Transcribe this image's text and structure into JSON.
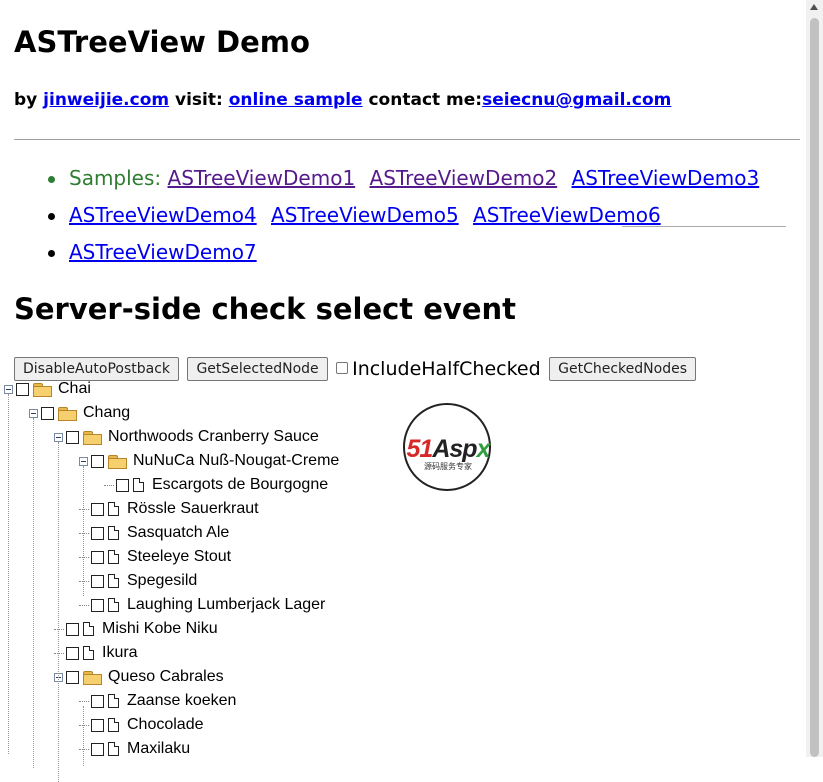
{
  "page": {
    "title": "ASTreeView Demo",
    "by_prefix": "by ",
    "author_link": "jinweijie.com",
    "visit_label": " visit: ",
    "online_link": "online sample",
    "contact_label": " contact me:",
    "email_link": "seiecnu@gmail.com"
  },
  "samples": {
    "label": "Samples:",
    "links": [
      "ASTreeViewDemo1",
      "ASTreeViewDemo2",
      "ASTreeViewDemo3",
      "ASTreeViewDemo4",
      "ASTreeViewDemo5",
      "ASTreeViewDemo6",
      "ASTreeViewDemo7"
    ]
  },
  "section_title": "Server-side check select event",
  "toolbar": {
    "disable_autopostback": "DisableAutoPostback",
    "get_selected_node": "GetSelectedNode",
    "include_half_checked": "IncludeHalfChecked",
    "get_checked_nodes": "GetCheckedNodes"
  },
  "tree": [
    {
      "label": "Chai",
      "type": "folder",
      "depth": 0,
      "expanded": true
    },
    {
      "label": "Chang",
      "type": "folder",
      "depth": 1,
      "expanded": true
    },
    {
      "label": "Northwoods Cranberry Sauce",
      "type": "folder",
      "depth": 2,
      "expanded": true
    },
    {
      "label": "NuNuCa Nuß-Nougat-Creme",
      "type": "folder",
      "depth": 3,
      "expanded": true
    },
    {
      "label": "Escargots de Bourgogne",
      "type": "file",
      "depth": 4
    },
    {
      "label": "Rössle Sauerkraut",
      "type": "file",
      "depth": 3
    },
    {
      "label": "Sasquatch Ale",
      "type": "file",
      "depth": 3
    },
    {
      "label": "Steeleye Stout",
      "type": "file",
      "depth": 3
    },
    {
      "label": "Spegesild",
      "type": "file",
      "depth": 3
    },
    {
      "label": "Laughing Lumberjack Lager",
      "type": "file",
      "depth": 3
    },
    {
      "label": "Mishi Kobe Niku",
      "type": "file",
      "depth": 2
    },
    {
      "label": "Ikura",
      "type": "file",
      "depth": 2
    },
    {
      "label": "Queso Cabrales",
      "type": "folder",
      "depth": 2,
      "expanded": true
    },
    {
      "label": "Zaanse koeken",
      "type": "file",
      "depth": 3
    },
    {
      "label": "Chocolade",
      "type": "file",
      "depth": 3
    },
    {
      "label": "Maxilaku",
      "type": "file",
      "depth": 3
    }
  ],
  "logo": {
    "brand_num": "51",
    "brand_a": "A",
    "brand_sp": "sp",
    "brand_x": "x",
    "subtitle": "源码服务专家"
  }
}
